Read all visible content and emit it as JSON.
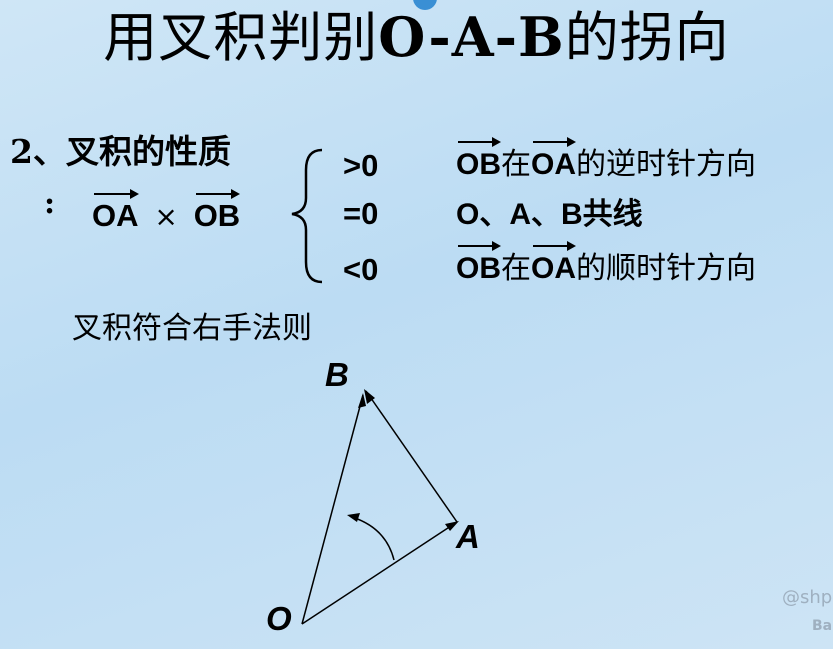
{
  "title_cn_prefix": "用叉积判别",
  "title_latin": "O-A-B",
  "title_cn_suffix": "的拐向",
  "property_heading": "2、叉积的性质",
  "colon": ":",
  "expr": {
    "left": "OA",
    "times": "×",
    "right": "OB"
  },
  "cases": [
    {
      "cond": ">0",
      "vec1": "OB",
      "mid": "在",
      "vec2": "OA",
      "tail": "的逆时针方向"
    },
    {
      "cond": "=0",
      "text": "O、A、B共线"
    },
    {
      "cond": "<0",
      "vec1": "OB",
      "mid": "在",
      "vec2": "OA",
      "tail": "的顺时针方向"
    }
  ],
  "rule_text": "叉积符合右手法则",
  "diagram_labels": {
    "B": "B",
    "A": "A",
    "O": "O"
  },
  "watermark_line1": "@shp",
  "watermark_line2": "Ba",
  "colors": {
    "background": "#c4e0f4",
    "text": "#000000",
    "accent_dot": "#3a8fd4"
  }
}
